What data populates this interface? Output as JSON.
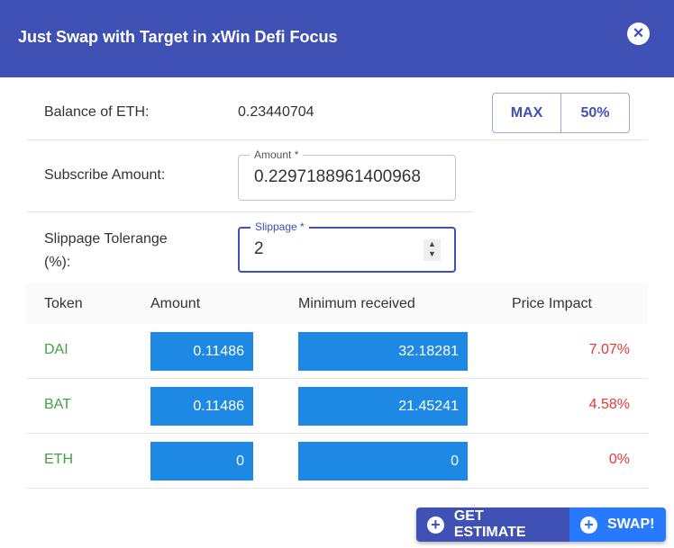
{
  "dialog": {
    "title": "Just Swap with Target in xWin Defi Focus",
    "close_icon": "close-circle-icon"
  },
  "balance": {
    "label": "Balance of ETH:",
    "value": "0.23440704",
    "max_label": "MAX",
    "half_label": "50%"
  },
  "subscribe": {
    "label": "Subscribe Amount:",
    "field_label": "Amount *",
    "value": "0.2297188961400968"
  },
  "slippage": {
    "label": "Slippage Tolerange (%):",
    "field_label": "Slippage *",
    "value": "2"
  },
  "table": {
    "headers": [
      "Token",
      "Amount",
      "Minimum received",
      "Price Impact"
    ],
    "rows": [
      {
        "token": "DAI",
        "amount": "0.11486",
        "min": "32.18281",
        "impact": "7.07%"
      },
      {
        "token": "BAT",
        "amount": "0.11486",
        "min": "21.45241",
        "impact": "4.58%"
      },
      {
        "token": "ETH",
        "amount": "0",
        "min": "0",
        "impact": "0%"
      }
    ]
  },
  "actions": {
    "estimate_label": "GET ESTIMATE",
    "swap_label": "SWAP!"
  },
  "colors": {
    "primary": "#3f51b5",
    "cell": "#1e88e5",
    "swap": "#2979ff",
    "token": "#43a047",
    "impact": "#e53935"
  }
}
